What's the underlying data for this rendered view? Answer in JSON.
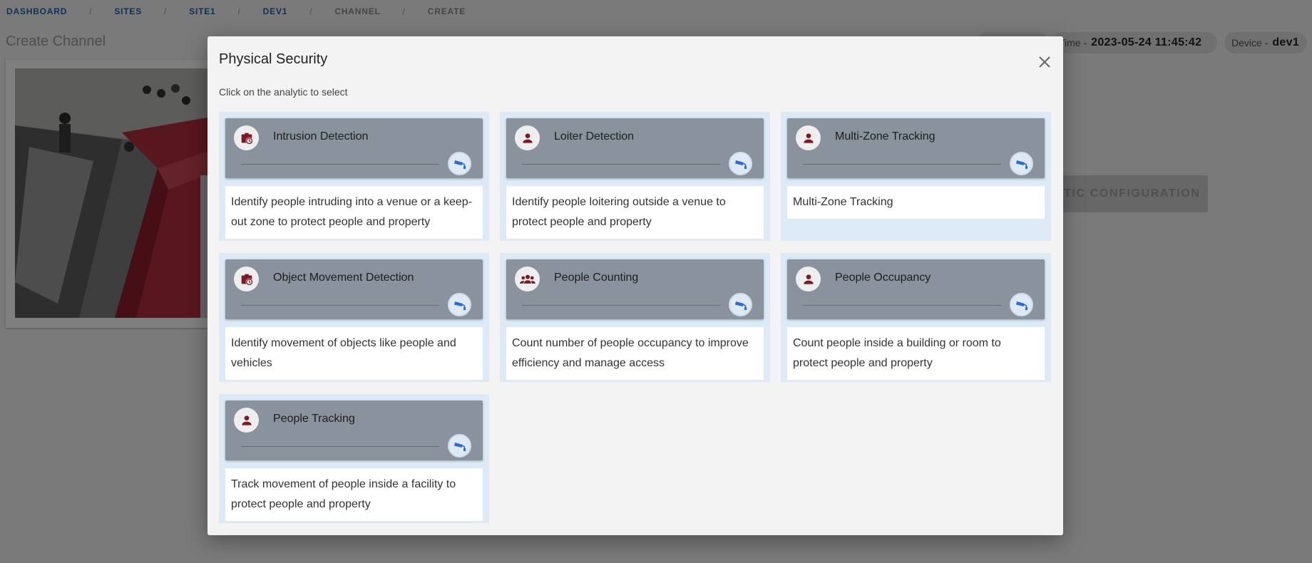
{
  "breadcrumb": [
    {
      "label": "DASHBOARD"
    },
    {
      "label": "SITES"
    },
    {
      "label": "SITE1"
    },
    {
      "label": "DEV1"
    },
    {
      "label": "CHANNEL"
    },
    {
      "label": "CREATE"
    }
  ],
  "page": {
    "title": "Create Channel",
    "time_label": "Time -",
    "time_value": "2023-05-24 11:45:42",
    "device_label": "Device -",
    "device_value": "dev1",
    "config_button": "ANALYTIC CONFIGURATION"
  },
  "modal": {
    "title": "Physical Security",
    "subtitle": "Click on the analytic to select",
    "cards": [
      {
        "title": "Intrusion Detection",
        "icon": "briefcase-clock-icon",
        "description": "Identify people intruding into a venue or a keep-out zone to protect people and property"
      },
      {
        "title": "Loiter Detection",
        "icon": "person-icon",
        "description": "Identify people loitering outside a venue to protect people and property"
      },
      {
        "title": "Multi-Zone Tracking",
        "icon": "person-icon",
        "description": "Multi-Zone Tracking"
      },
      {
        "title": "Object Movement Detection",
        "icon": "briefcase-clock-icon",
        "description": "Identify movement of objects like people and vehicles"
      },
      {
        "title": "People Counting",
        "icon": "group-icon",
        "description": "Count number of people occupancy to improve efficiency and manage access"
      },
      {
        "title": "People Occupancy",
        "icon": "person-icon",
        "description": "Count people inside a building or room to protect people and property"
      },
      {
        "title": "People Tracking",
        "icon": "person-icon",
        "description": "Track movement of people inside a facility to protect people and property"
      }
    ]
  },
  "colors": {
    "accent": "#1e63b0",
    "icon_maroon": "#7b1a26",
    "card_header": "#8a929d",
    "card_bg": "#dceaf7"
  }
}
